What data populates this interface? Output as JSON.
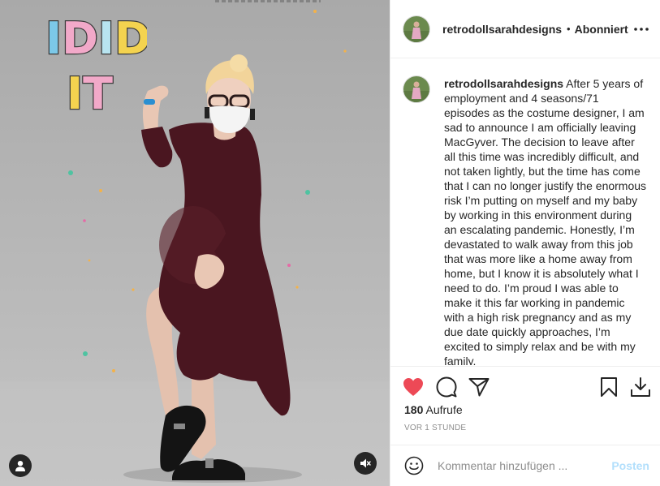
{
  "post": {
    "username": "retrodollsarahdesigns",
    "follow_status": "Abonniert",
    "separator": "•",
    "caption_text": "After 5 years of employment and 4 seasons/71 episodes as the costume designer, I am sad to announce I am officially leaving MacGyver. The decision to leave after all this time was incredibly difficult, and not taken lightly, but the time has come that I can no longer justify the enormous risk I’m putting on myself and my baby by working in this environment during an escalating pandemic. Honestly, I’m devastated to walk away from this job that was more like a home away from home, but I know it is absolutely what I need to do. I’m proud I was able to make it this far working in pandemic with a high risk pregnancy and as my due date quickly approaches, I’m excited to simply relax and be with my family.",
    "views_count": "180",
    "views_label": "Aufrufe",
    "time_ago": "Vor 1 Stunde",
    "liked": true
  },
  "media": {
    "sticker_line1": "IDID",
    "sticker_line2": "IT"
  },
  "comment_box": {
    "placeholder": "Kommentar hinzufügen ...",
    "post_label": "Posten"
  },
  "colors": {
    "like_red": "#ed4956",
    "dress": "#4a1620",
    "post_disabled": "#b2dffc",
    "muted_text": "#8e8e8e"
  },
  "icons": [
    "user-tag-icon",
    "mute-icon",
    "more-options-icon",
    "heart-icon",
    "comment-icon",
    "share-icon",
    "bookmark-icon",
    "download-icon",
    "emoji-icon"
  ]
}
